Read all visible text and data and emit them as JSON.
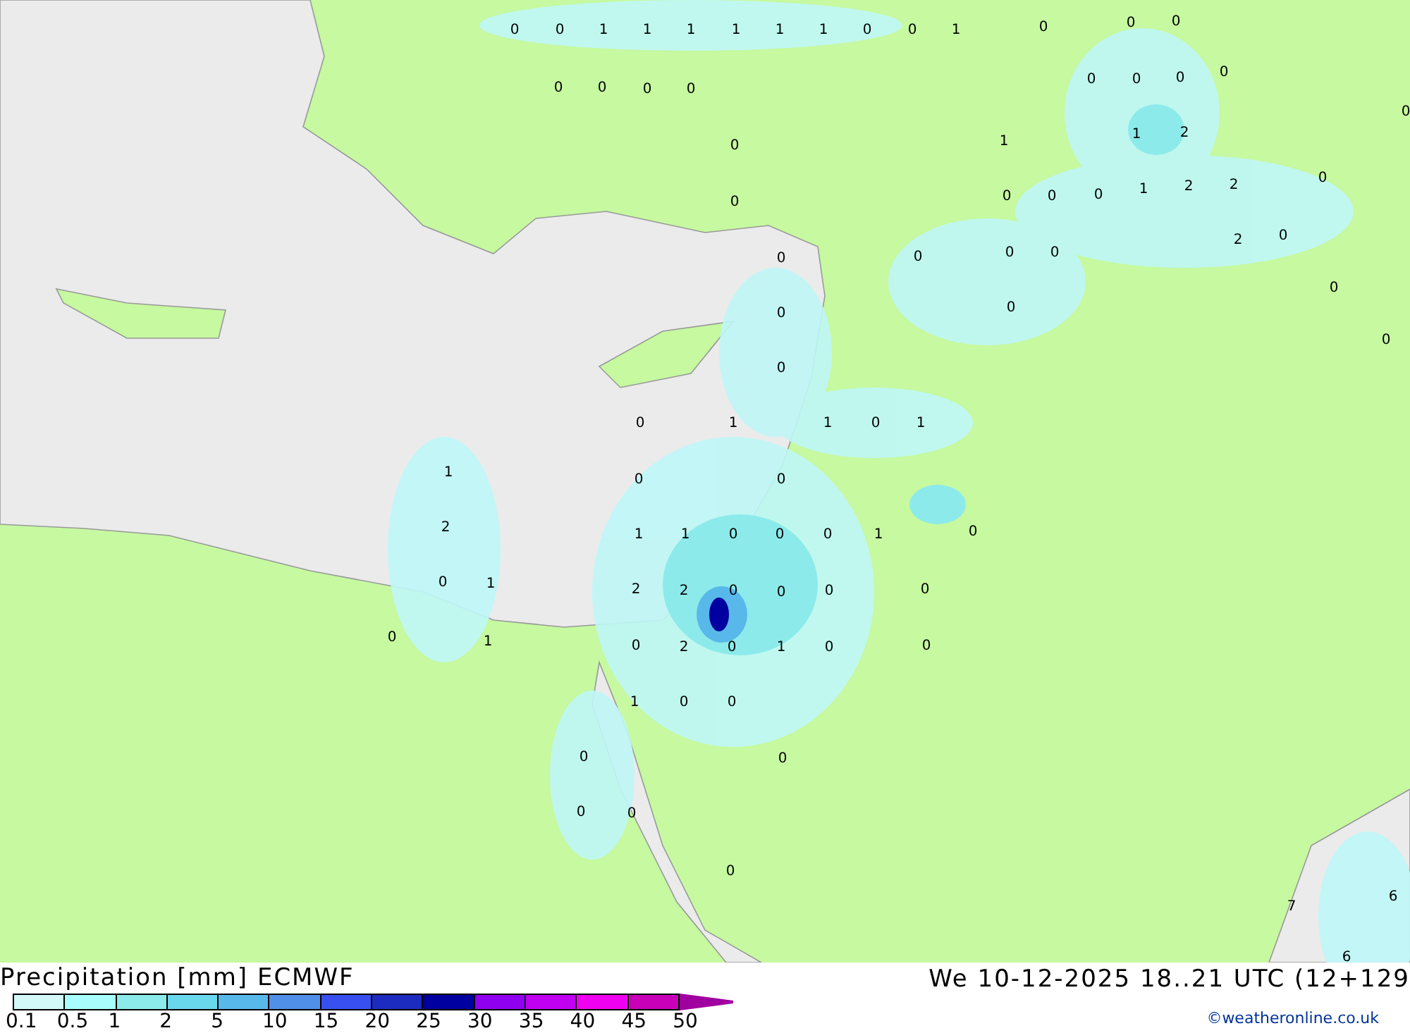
{
  "map": {
    "value_labels": [
      "0",
      "0",
      "1",
      "1",
      "1",
      "1",
      "1",
      "1",
      "0",
      "0",
      "1",
      "0",
      "0",
      "0",
      "0",
      "0",
      "0",
      "0",
      "0",
      "0",
      "0",
      "0",
      "0",
      "1",
      "2",
      "1",
      "0",
      "0",
      "2",
      "2",
      "0",
      "0",
      "0",
      "1",
      "0",
      "2",
      "0",
      "0",
      "0",
      "0",
      "0",
      "0",
      "0",
      "0",
      "0",
      "0",
      "0",
      "1",
      "1",
      "0",
      "1",
      "1",
      "0",
      "0",
      "2",
      "1",
      "1",
      "0",
      "0",
      "0",
      "1",
      "0",
      "0",
      "1",
      "2",
      "2",
      "0",
      "0",
      "0",
      "0",
      "0",
      "1",
      "0",
      "2",
      "0",
      "1",
      "0",
      "0",
      "1",
      "0",
      "0",
      "0",
      "0",
      "0",
      "0",
      "0",
      "7",
      "6",
      "6"
    ]
  },
  "legend": {
    "title": "Precipitation [mm] ECMWF",
    "bins": [
      {
        "color": "#d2f8f8"
      },
      {
        "color": "#a8fcfc"
      },
      {
        "color": "#8ceaea"
      },
      {
        "color": "#6ad8ec"
      },
      {
        "color": "#58b8ea"
      },
      {
        "color": "#5090e8"
      },
      {
        "color": "#3850f0"
      },
      {
        "color": "#1c2cc0"
      },
      {
        "color": "#0000a0"
      },
      {
        "color": "#9000f0"
      },
      {
        "color": "#c000f0"
      },
      {
        "color": "#f000f0"
      },
      {
        "color": "#c800b8"
      }
    ],
    "ticks": [
      "0.1",
      "0.5",
      "1",
      "2",
      "5",
      "10",
      "15",
      "20",
      "25",
      "30",
      "35",
      "40",
      "45",
      "50"
    ]
  },
  "valid_time": "We 10-12-2025 18..21 UTC (12+129",
  "credit": "©weatheronline.co.uk"
}
